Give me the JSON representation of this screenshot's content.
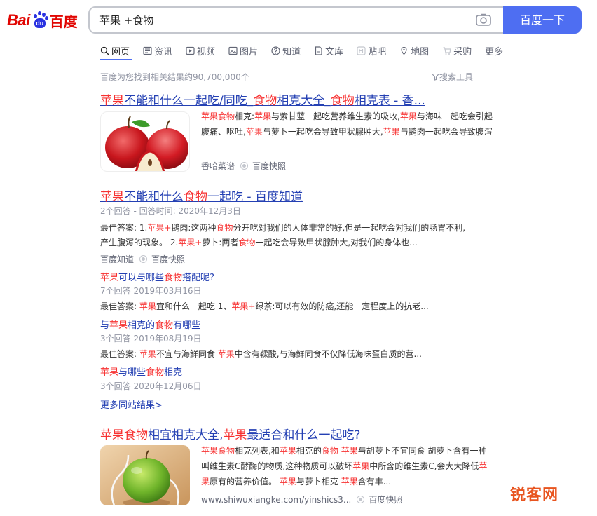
{
  "logo": {
    "text_left": "Bai",
    "text_paw": "du",
    "text_right": "百度"
  },
  "search": {
    "query": "苹果 +食物",
    "button_label": "百度一下"
  },
  "tabs": [
    {
      "label": "网页",
      "icon": "search-icon",
      "active": true
    },
    {
      "label": "资讯",
      "icon": "news-icon"
    },
    {
      "label": "视频",
      "icon": "video-icon"
    },
    {
      "label": "图片",
      "icon": "image-icon"
    },
    {
      "label": "知道",
      "icon": "question-icon"
    },
    {
      "label": "文库",
      "icon": "doc-icon"
    },
    {
      "label": "贴吧",
      "icon": "tieba-icon"
    },
    {
      "label": "地图",
      "icon": "map-icon"
    },
    {
      "label": "采购",
      "icon": "cart-icon"
    },
    {
      "label": "更多"
    }
  ],
  "result_count": "百度为您找到相关结果约90,700,000个",
  "search_tools": "搜索工具",
  "result1": {
    "title_parts": [
      "苹果",
      "不能和什么一起吃/同吃_",
      "食物",
      "相克大全_",
      "食物",
      "相克表 - 香..."
    ],
    "abstract": [
      [
        "苹果食物",
        "相克:"
      ],
      [
        "苹果",
        "与紫甘蓝一起吃营养维生素的吸收,"
      ],
      [
        "苹果",
        "与海味一起吃会引起腹痛、呕吐,"
      ],
      [
        "苹果",
        "与萝卜一起吃会导致甲状腺肿大,"
      ],
      [
        "苹果",
        "与鹅肉一起吃会导致腹泻"
      ]
    ],
    "source": "香哈菜谱",
    "cache": "百度快照"
  },
  "result2": {
    "title_parts": [
      "苹果",
      "不能和什么",
      "食物",
      "一起吃 - 百度知道"
    ],
    "meta": "2个回答 - 回答时间: 2020年12月3日",
    "answer_l1": [
      "最佳答案: 1.",
      "苹果+",
      "鹅肉:这两种",
      "食物",
      "分开吃对我们的人体非常的好,但是一起吃会对我们的肠胃不利,"
    ],
    "answer_l2": [
      "产生腹泻的现象。 2.",
      "苹果+",
      "萝卜:两者",
      "食物",
      "一起吃会导致甲状腺肿大,对我们的身体也..."
    ],
    "source": "百度知道",
    "cache": "百度快照",
    "related": [
      {
        "q": [
          "苹果",
          "可以与哪些",
          "食物",
          "搭配呢?"
        ],
        "meta": "7个回答   2019年03月16日",
        "ans": [
          "最佳答案: ",
          "苹果",
          "宜和什么一起吃 1、",
          "苹果+",
          "绿茶:可以有效的防癌,还能一定程度上的抗老..."
        ]
      },
      {
        "q": [
          "与",
          "苹果",
          "相克的",
          "食物",
          "有哪些"
        ],
        "meta": "3个回答   2019年08月19日",
        "ans": [
          "最佳答案: ",
          "苹果",
          "不宜与海鲜同食 ",
          "苹果",
          "中含有鞣酸,与海鲜同食不仅降低海味蛋白质的营..."
        ]
      },
      {
        "q": [
          "苹果",
          "与哪些",
          "食物",
          "相克"
        ],
        "meta": "3个回答   2020年12月06日"
      }
    ],
    "more": "更多同站结果>"
  },
  "result3": {
    "title_parts": [
      "苹果食物",
      "相宜相克大全,",
      "苹果",
      "最适合和什么一起吃?"
    ],
    "abstract": [
      [
        "苹果食物",
        "相克列表,和"
      ],
      [
        "苹果",
        "相克的"
      ],
      [
        "食物",
        " "
      ],
      [
        "苹果",
        "与胡萝卜不宜同食 胡萝卜含有一种叫维生素C酵酶的物质,这种物质可以破坏"
      ],
      [
        "苹果",
        "中所含的维生素C,会大大降低"
      ],
      [
        "苹果",
        "原有的营养价值。 "
      ],
      [
        "苹果",
        "与萝卜相克 "
      ],
      [
        "苹果",
        "含有丰..."
      ]
    ],
    "url": "www.shiwuxiangke.com/yinshics3...",
    "cache": "百度快照"
  },
  "watermark": "锐客网",
  "colors": {
    "brand_blue": "#4e6ef2",
    "link": "#2440b3",
    "highlight": "#f73131",
    "logo_red": "#e10602"
  }
}
